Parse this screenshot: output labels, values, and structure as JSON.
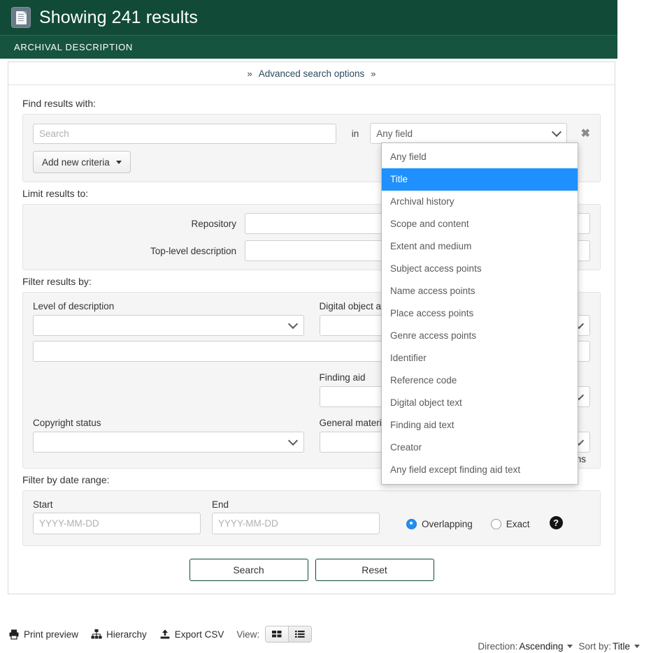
{
  "header": {
    "icon": "document-icon",
    "title": "Showing 241 results",
    "subtitle": "ARCHIVAL DESCRIPTION",
    "bg_color": "#114b38"
  },
  "advanced_bar": {
    "label": "Advanced search options",
    "chevron_left": "»",
    "chevron_right": "»"
  },
  "find_results": {
    "section_label": "Find results with:",
    "search_placeholder": "Search",
    "search_value": "",
    "in_word": "in",
    "field_select_value": "Any field",
    "remove_label": "✖",
    "add_criteria_label": "Add new criteria"
  },
  "field_options": [
    "Any field",
    "Title",
    "Archival history",
    "Scope and content",
    "Extent and medium",
    "Subject access points",
    "Name access points",
    "Place access points",
    "Genre access points",
    "Identifier",
    "Reference code",
    "Digital object text",
    "Finding aid text",
    "Creator",
    "Any field except finding aid text"
  ],
  "field_options_selected": "Title",
  "field_options_highlight_color": "#1e90ff",
  "limit_results": {
    "section_label": "Limit results to:",
    "repository_label": "Repository",
    "repository_value": "",
    "toplevel_label": "Top-level description",
    "toplevel_value": ""
  },
  "filter_results": {
    "section_label": "Filter results by:",
    "level_of_description_label": "Level of description",
    "level_of_description_value": "",
    "digital_object_label": "Digital object available",
    "digital_object_value": "",
    "wide_field_value": "",
    "finding_aid_label": "Finding aid",
    "finding_aid_value": "",
    "copyright_label": "Copyright status",
    "copyright_value": "",
    "general_material_label": "General material designation",
    "general_material_value": "",
    "truncated_right_text": "ons"
  },
  "date_range": {
    "section_label": "Filter by date range:",
    "start_label": "Start",
    "start_placeholder": "YYYY-MM-DD",
    "start_value": "",
    "end_label": "End",
    "end_placeholder": "YYYY-MM-DD",
    "end_value": "",
    "overlapping_label": "Overlapping",
    "exact_label": "Exact",
    "selected_mode": "Overlapping",
    "help_icon": "question-mark-icon"
  },
  "actions": {
    "search_label": "Search",
    "reset_label": "Reset",
    "border_color": "#0d4a36"
  },
  "bottom_bar": {
    "print_preview_label": "Print preview",
    "hierarchy_label": "Hierarchy",
    "export_csv_label": "Export CSV",
    "view_label": "View:",
    "view_grid_icon": "grid-view-icon",
    "view_list_icon": "list-view-icon",
    "active_view": "list"
  },
  "sort_bar": {
    "direction_label": "Direction:",
    "direction_value": "Ascending",
    "sort_by_label": "Sort by:",
    "sort_by_value": "Title"
  }
}
